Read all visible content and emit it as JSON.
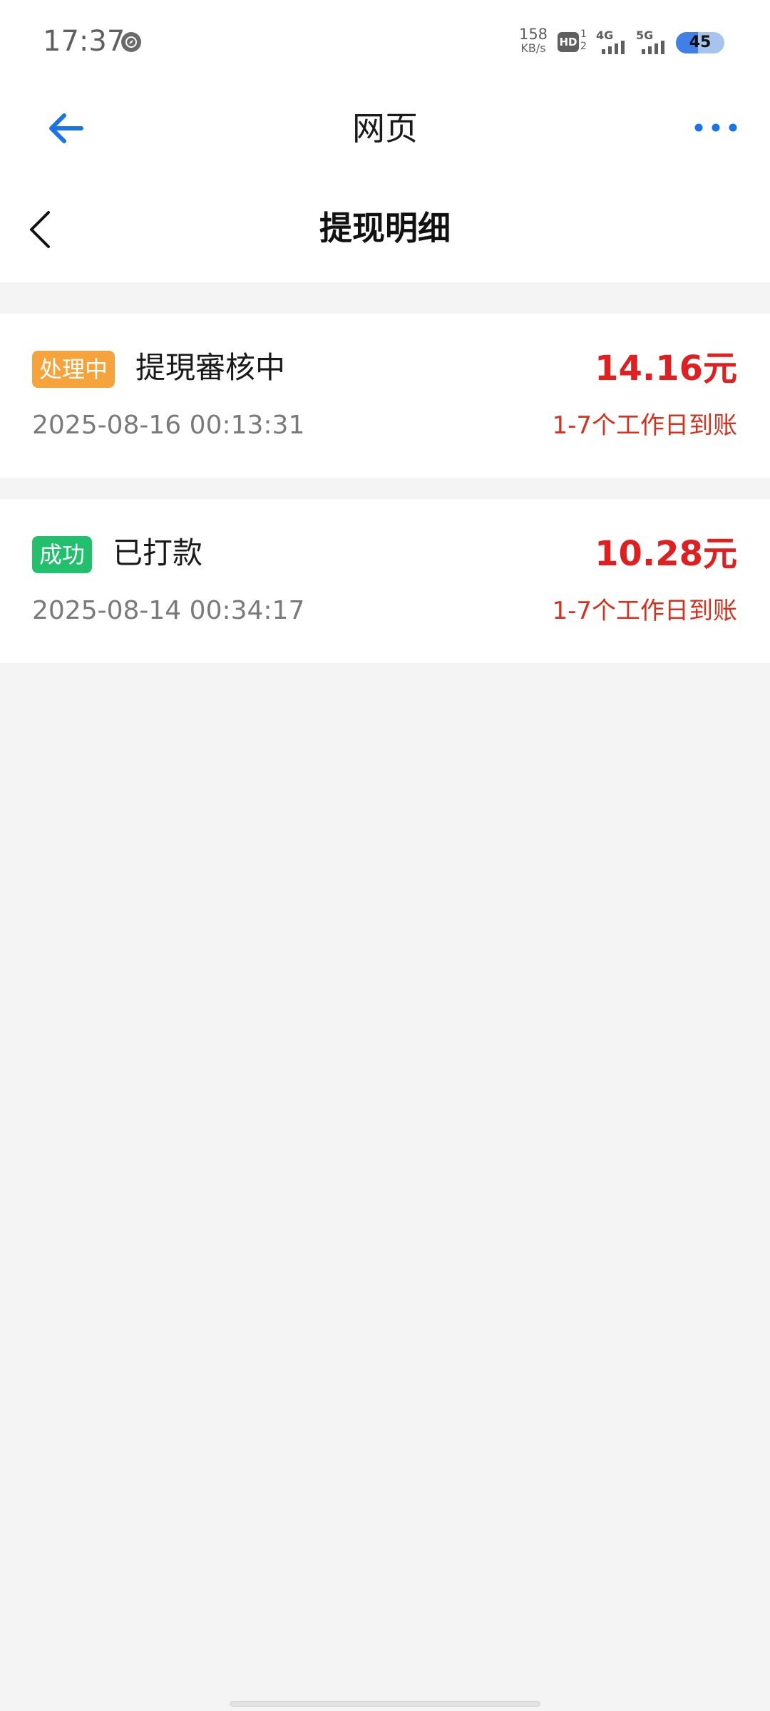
{
  "status_bar": {
    "time": "17:37",
    "app_icon": "compass-icon",
    "net_speed_value": "158",
    "net_speed_unit": "KB/s",
    "hd_label": "HD",
    "hd_sim_top": "1",
    "hd_sim_bottom": "2",
    "sim1_label": "4G",
    "sim2_label": "5G",
    "battery_level": 45,
    "battery_text": "45"
  },
  "browser": {
    "title": "网页",
    "back_icon": "arrow-left-icon",
    "menu_icon": "more-dots-icon",
    "accent_color": "#1a73e8"
  },
  "header": {
    "title": "提现明细",
    "back_icon": "chevron-left-icon"
  },
  "records": [
    {
      "status": "处理中",
      "status_color": "#f5a33a",
      "title": "提現審核中",
      "amount": "14.16元",
      "time": "2025-08-16 00:13:31",
      "eta": "1-7个工作日到账"
    },
    {
      "status": "成功",
      "status_color": "#22c06d",
      "title": "已打款",
      "amount": "10.28元",
      "time": "2025-08-14 00:34:17",
      "eta": "1-7个工作日到账"
    }
  ],
  "colors": {
    "amount": "#e02020",
    "background": "#f4f4f4"
  }
}
